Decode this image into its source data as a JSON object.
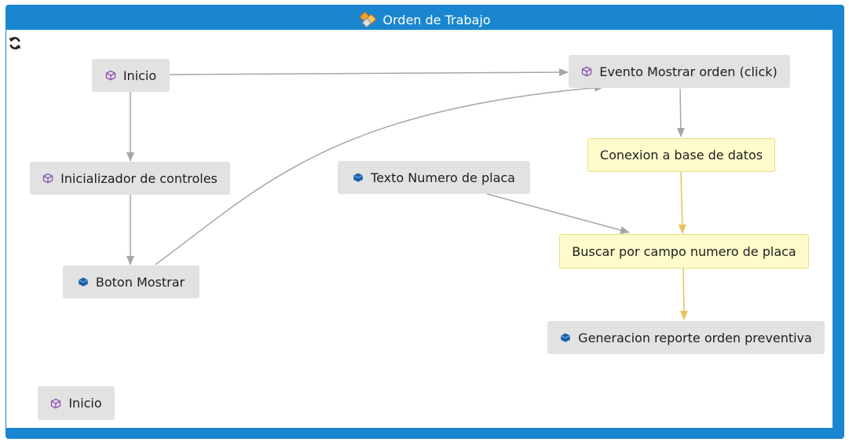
{
  "window": {
    "title": "Orden de Trabajo"
  },
  "colors": {
    "frame": "#1b86d0",
    "node_gray": "#e2e2e2",
    "node_yellow": "#fffbcc",
    "link_gray": "#a6a6a6",
    "link_yellow": "#e8c25a",
    "component_icon": "#8a4fb4",
    "object_icon": "#1a5faa"
  },
  "nodes": [
    {
      "id": "inicio",
      "label": "Inicio",
      "icon": "component-icon"
    },
    {
      "id": "evento",
      "label": "Evento Mostrar orden (click)",
      "icon": "component-icon"
    },
    {
      "id": "inicializador",
      "label": "Inicializador de controles",
      "icon": "component-icon"
    },
    {
      "id": "texto",
      "label": "Texto Numero de placa",
      "icon": "object-icon"
    },
    {
      "id": "conexion",
      "label": "Conexion a base de datos",
      "icon": "none"
    },
    {
      "id": "buscar",
      "label": "Buscar por campo numero de placa",
      "icon": "none"
    },
    {
      "id": "boton",
      "label": "Boton Mostrar",
      "icon": "object-icon"
    },
    {
      "id": "generacion",
      "label": "Generacion reporte orden preventiva",
      "icon": "object-icon"
    },
    {
      "id": "inicio2",
      "label": "Inicio",
      "icon": "component-icon"
    }
  ],
  "links": [
    {
      "from": "Inicio",
      "to": "Evento Mostrar orden (click)",
      "style": "gray"
    },
    {
      "from": "Inicio",
      "to": "Inicializador de controles",
      "style": "gray"
    },
    {
      "from": "Inicializador de controles",
      "to": "Boton Mostrar",
      "style": "gray"
    },
    {
      "from": "Boton Mostrar",
      "to": "Evento Mostrar orden (click)",
      "style": "gray"
    },
    {
      "from": "Evento Mostrar orden (click)",
      "to": "Conexion a base de datos",
      "style": "gray"
    },
    {
      "from": "Texto Numero de placa",
      "to": "Buscar por campo numero de placa",
      "style": "gray"
    },
    {
      "from": "Conexion a base de datos",
      "to": "Buscar por campo numero de placa",
      "style": "yellow"
    },
    {
      "from": "Buscar por campo numero de placa",
      "to": "Generacion reporte orden preventiva",
      "style": "yellow"
    }
  ]
}
